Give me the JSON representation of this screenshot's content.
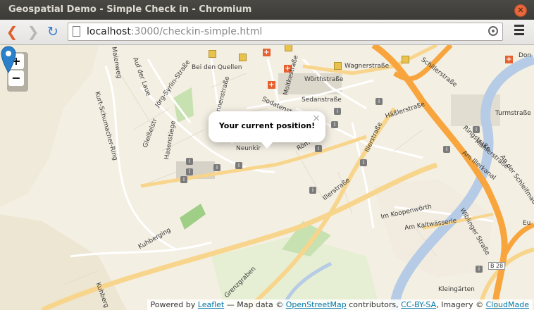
{
  "window": {
    "title": "Geospatial Demo - Simple Check in - Chromium"
  },
  "toolbar": {
    "url_host": "localhost",
    "url_rest": ":3000/checkin-simple.html"
  },
  "map": {
    "zoom_in": "+",
    "zoom_out": "−",
    "popup_text": "Your current position!",
    "popup_close": "×",
    "labels": {
      "bei_den_quellen": "Bei den Quellen",
      "wagnerstrasse": "Wagnerstraße",
      "woerthstrasse": "Wörthstraße",
      "sedanstrasse": "Sedanstraße",
      "haesslerstrasse": "Häßlerstraße",
      "schillerstrasse": "Schillerstraße",
      "turmstrasse": "Turmstraße",
      "donau": "Don",
      "ringstrasse": "Ringstraße",
      "mahlerstrasse": "Mahlerstraße",
      "illerkanal": "Am Illerkanal",
      "schleifenwaeger": "An der Schleifmauer",
      "koopenwoerth": "Im Koopenwörth",
      "kaltwaesserle": "Am Kaltwässerle",
      "illerstrasse": "Illerstraße",
      "illerstrasse2": "Illerstraße",
      "grenzgraben": "Grenzgraben",
      "kuhberg": "Kuhberging",
      "kleingaerten": "Kleingärten",
      "b28": "B 28",
      "kurt_schumacher": "Kurt-Schumacher-Ring",
      "auf_der_laue": "Auf der Laue",
      "joerg_syrlin": "Jörg-Syrlin-Straße",
      "sonnenstrasse": "Sonnenstraße",
      "moltkestrasse": "Moltkestraße",
      "sodatenstrasse": "Sodatenstr",
      "gleissleistr": "Gleißelstr",
      "hasenstiege": "Hasenstiege",
      "neunkir": "Neunkir",
      "roma": "Röm",
      "maienweg": "Maienweg",
      "wibinger": "Wiblinger Straße",
      "eu": "Eu",
      "kurze": "Kuhberg"
    },
    "attribution": {
      "prefix": "Powered by",
      "leaflet": "Leaflet",
      "map_data": "— Map data ©",
      "osm": "OpenStreetMap",
      "contributors": "contributors,",
      "ccbysa": "CC-BY-SA",
      "imagery": ", Imagery ©",
      "cloudmade": "CloudMade"
    }
  },
  "colors": {
    "motorway": "#f7a53c",
    "primary": "#f8d58c",
    "river": "#b6cbe5",
    "park": "#c8e1b0",
    "land": "#f4efe3",
    "marker": "#2a80cb"
  }
}
